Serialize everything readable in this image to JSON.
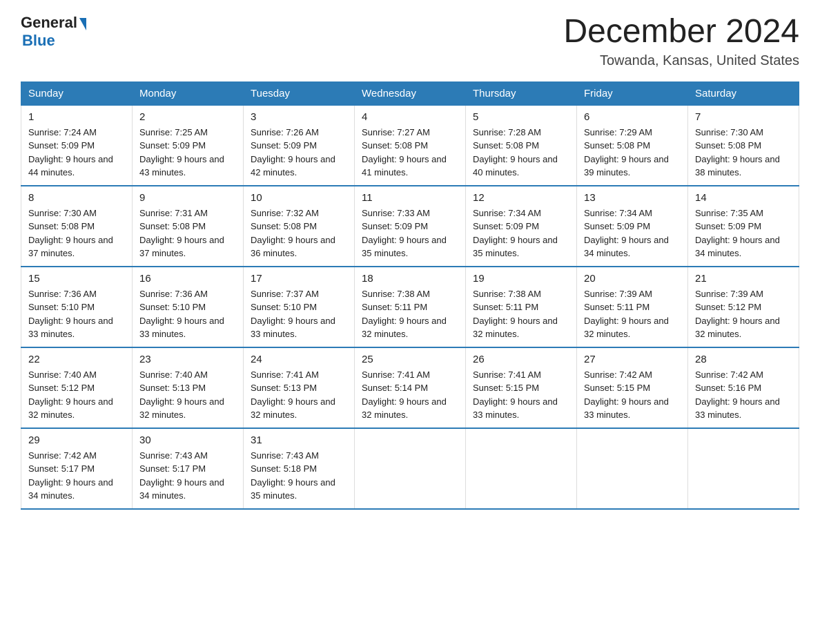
{
  "logo": {
    "general": "General",
    "blue": "Blue"
  },
  "title": "December 2024",
  "location": "Towanda, Kansas, United States",
  "days_of_week": [
    "Sunday",
    "Monday",
    "Tuesday",
    "Wednesday",
    "Thursday",
    "Friday",
    "Saturday"
  ],
  "weeks": [
    [
      {
        "day": "1",
        "sunrise": "7:24 AM",
        "sunset": "5:09 PM",
        "daylight": "9 hours and 44 minutes."
      },
      {
        "day": "2",
        "sunrise": "7:25 AM",
        "sunset": "5:09 PM",
        "daylight": "9 hours and 43 minutes."
      },
      {
        "day": "3",
        "sunrise": "7:26 AM",
        "sunset": "5:09 PM",
        "daylight": "9 hours and 42 minutes."
      },
      {
        "day": "4",
        "sunrise": "7:27 AM",
        "sunset": "5:08 PM",
        "daylight": "9 hours and 41 minutes."
      },
      {
        "day": "5",
        "sunrise": "7:28 AM",
        "sunset": "5:08 PM",
        "daylight": "9 hours and 40 minutes."
      },
      {
        "day": "6",
        "sunrise": "7:29 AM",
        "sunset": "5:08 PM",
        "daylight": "9 hours and 39 minutes."
      },
      {
        "day": "7",
        "sunrise": "7:30 AM",
        "sunset": "5:08 PM",
        "daylight": "9 hours and 38 minutes."
      }
    ],
    [
      {
        "day": "8",
        "sunrise": "7:30 AM",
        "sunset": "5:08 PM",
        "daylight": "9 hours and 37 minutes."
      },
      {
        "day": "9",
        "sunrise": "7:31 AM",
        "sunset": "5:08 PM",
        "daylight": "9 hours and 37 minutes."
      },
      {
        "day": "10",
        "sunrise": "7:32 AM",
        "sunset": "5:08 PM",
        "daylight": "9 hours and 36 minutes."
      },
      {
        "day": "11",
        "sunrise": "7:33 AM",
        "sunset": "5:09 PM",
        "daylight": "9 hours and 35 minutes."
      },
      {
        "day": "12",
        "sunrise": "7:34 AM",
        "sunset": "5:09 PM",
        "daylight": "9 hours and 35 minutes."
      },
      {
        "day": "13",
        "sunrise": "7:34 AM",
        "sunset": "5:09 PM",
        "daylight": "9 hours and 34 minutes."
      },
      {
        "day": "14",
        "sunrise": "7:35 AM",
        "sunset": "5:09 PM",
        "daylight": "9 hours and 34 minutes."
      }
    ],
    [
      {
        "day": "15",
        "sunrise": "7:36 AM",
        "sunset": "5:10 PM",
        "daylight": "9 hours and 33 minutes."
      },
      {
        "day": "16",
        "sunrise": "7:36 AM",
        "sunset": "5:10 PM",
        "daylight": "9 hours and 33 minutes."
      },
      {
        "day": "17",
        "sunrise": "7:37 AM",
        "sunset": "5:10 PM",
        "daylight": "9 hours and 33 minutes."
      },
      {
        "day": "18",
        "sunrise": "7:38 AM",
        "sunset": "5:11 PM",
        "daylight": "9 hours and 32 minutes."
      },
      {
        "day": "19",
        "sunrise": "7:38 AM",
        "sunset": "5:11 PM",
        "daylight": "9 hours and 32 minutes."
      },
      {
        "day": "20",
        "sunrise": "7:39 AM",
        "sunset": "5:11 PM",
        "daylight": "9 hours and 32 minutes."
      },
      {
        "day": "21",
        "sunrise": "7:39 AM",
        "sunset": "5:12 PM",
        "daylight": "9 hours and 32 minutes."
      }
    ],
    [
      {
        "day": "22",
        "sunrise": "7:40 AM",
        "sunset": "5:12 PM",
        "daylight": "9 hours and 32 minutes."
      },
      {
        "day": "23",
        "sunrise": "7:40 AM",
        "sunset": "5:13 PM",
        "daylight": "9 hours and 32 minutes."
      },
      {
        "day": "24",
        "sunrise": "7:41 AM",
        "sunset": "5:13 PM",
        "daylight": "9 hours and 32 minutes."
      },
      {
        "day": "25",
        "sunrise": "7:41 AM",
        "sunset": "5:14 PM",
        "daylight": "9 hours and 32 minutes."
      },
      {
        "day": "26",
        "sunrise": "7:41 AM",
        "sunset": "5:15 PM",
        "daylight": "9 hours and 33 minutes."
      },
      {
        "day": "27",
        "sunrise": "7:42 AM",
        "sunset": "5:15 PM",
        "daylight": "9 hours and 33 minutes."
      },
      {
        "day": "28",
        "sunrise": "7:42 AM",
        "sunset": "5:16 PM",
        "daylight": "9 hours and 33 minutes."
      }
    ],
    [
      {
        "day": "29",
        "sunrise": "7:42 AM",
        "sunset": "5:17 PM",
        "daylight": "9 hours and 34 minutes."
      },
      {
        "day": "30",
        "sunrise": "7:43 AM",
        "sunset": "5:17 PM",
        "daylight": "9 hours and 34 minutes."
      },
      {
        "day": "31",
        "sunrise": "7:43 AM",
        "sunset": "5:18 PM",
        "daylight": "9 hours and 35 minutes."
      },
      null,
      null,
      null,
      null
    ]
  ]
}
